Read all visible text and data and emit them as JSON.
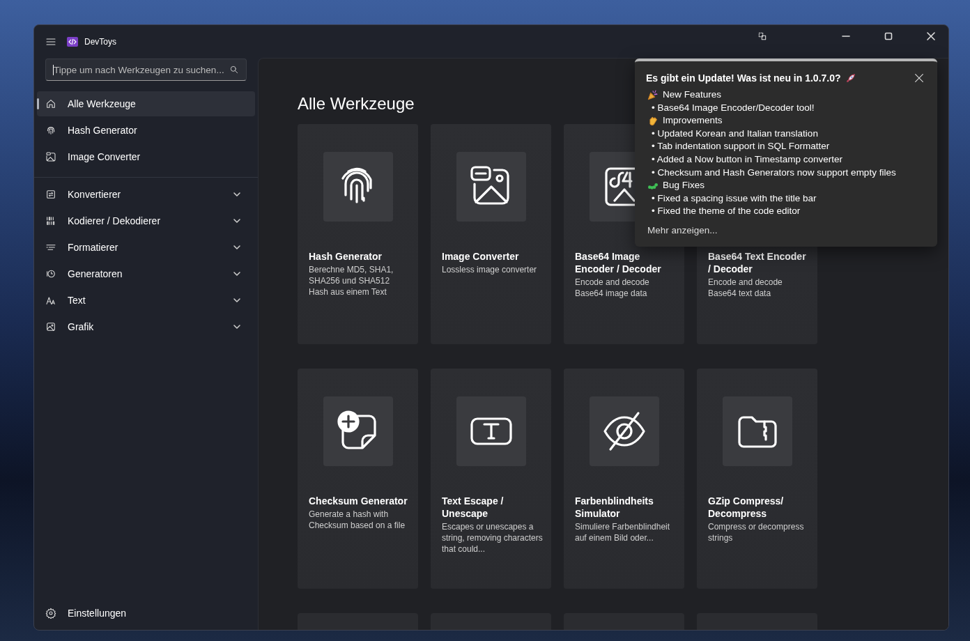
{
  "window": {
    "title": "DevToys"
  },
  "search": {
    "placeholder": "Tippe um nach Werkzeugen zu suchen..."
  },
  "sidebar": {
    "items": [
      {
        "label": "Alle Werkzeuge",
        "selected": true
      },
      {
        "label": "Hash Generator",
        "selected": false
      },
      {
        "label": "Image Converter",
        "selected": false
      }
    ],
    "categories": [
      {
        "label": "Konvertierer",
        "expanded": false
      },
      {
        "label": "Kodierer / Dekodierer",
        "expanded": false
      },
      {
        "label": "Formatierer",
        "expanded": false
      },
      {
        "label": "Generatoren",
        "expanded": false
      },
      {
        "label": "Text",
        "expanded": false
      },
      {
        "label": "Grafik",
        "expanded": false
      }
    ],
    "footer": {
      "label": "Einstellungen"
    }
  },
  "page": {
    "title": "Alle Werkzeuge",
    "cards": [
      {
        "title": "Hash Generator",
        "description": "Berechne MD5, SHA1, SHA256 und SHA512 Hash aus einem Text"
      },
      {
        "title": "Image Converter",
        "description": "Lossless image converter"
      },
      {
        "title": "Base64 Image Encoder / Decoder",
        "description": "Encode and decode Base64 image data"
      },
      {
        "title": "Base64 Text Encoder / Decoder",
        "description": "Encode and decode Base64 text data"
      },
      {
        "title": "Checksum Generator",
        "description": "Generate a hash with Checksum based on a file"
      },
      {
        "title": "Text Escape / Unescape",
        "description": "Escapes or unescapes a string, removing characters that could..."
      },
      {
        "title": "Farbenblindheits Simulator",
        "description": "Simuliere Farbenblindheit auf einem Bild oder..."
      },
      {
        "title": "GZip Compress/ Decompress",
        "description": "Compress or decompress strings"
      }
    ]
  },
  "update_popup": {
    "title": "Es gibt ein Update! Was ist neu in 1.0.7.0?",
    "lines": [
      {
        "kind": "heading",
        "text": "New Features"
      },
      {
        "kind": "bullet",
        "text": "• Base64 Image Encoder/Decoder tool!"
      },
      {
        "kind": "heading",
        "text": "Improvements"
      },
      {
        "kind": "bullet",
        "text": "• Updated Korean and Italian translation"
      },
      {
        "kind": "bullet",
        "text": "• Tab indentation support in SQL Formatter"
      },
      {
        "kind": "bullet",
        "text": "• Added a Now button in Timestamp converter"
      },
      {
        "kind": "bullet",
        "text": "• Checksum and Hash Generators now support empty files"
      },
      {
        "kind": "heading",
        "text": "Bug Fixes"
      },
      {
        "kind": "bullet",
        "text": "• Fixed a spacing issue with the title bar"
      },
      {
        "kind": "bullet",
        "text": "• Fixed the theme of the code editor"
      }
    ],
    "link": "Mehr anzeigen..."
  }
}
